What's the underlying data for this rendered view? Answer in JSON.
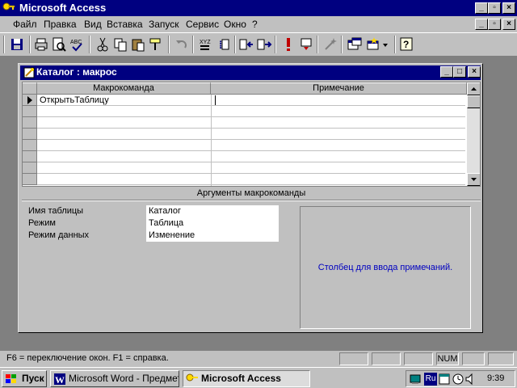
{
  "app": {
    "title": "Microsoft Access"
  },
  "menu": {
    "items": [
      {
        "label": "Файл"
      },
      {
        "label": "Правка"
      },
      {
        "label": "Вид"
      },
      {
        "label": "Вставка"
      },
      {
        "label": "Запуск"
      },
      {
        "label": "Сервис"
      },
      {
        "label": "Окно"
      },
      {
        "label": "?"
      }
    ]
  },
  "macro_window": {
    "title": "Каталог : макрос",
    "columns": [
      "Макрокоманда",
      "Примечание"
    ],
    "rows": [
      {
        "action": "ОткрытьТаблицу",
        "note": ""
      }
    ],
    "arguments_header": "Аргументы макрокоманды",
    "arguments": [
      {
        "label": "Имя таблицы",
        "value": "Каталог"
      },
      {
        "label": "Режим",
        "value": "Таблица"
      },
      {
        "label": "Режим данных",
        "value": "Изменение"
      }
    ],
    "hint": "Столбец для ввода примечаний."
  },
  "status": {
    "text": "F6 = переключение окон.  F1 = справка.",
    "num": "NUM"
  },
  "taskbar": {
    "start": "Пуск",
    "tasks": [
      "Microsoft Word - Предмет...",
      "Microsoft Access"
    ],
    "lang": "Ru",
    "clock": "9:39"
  },
  "colors": {
    "titlebar": "#000080",
    "face": "#c0c0c0",
    "desktop": "#808080",
    "hint_text": "#0000c0"
  }
}
